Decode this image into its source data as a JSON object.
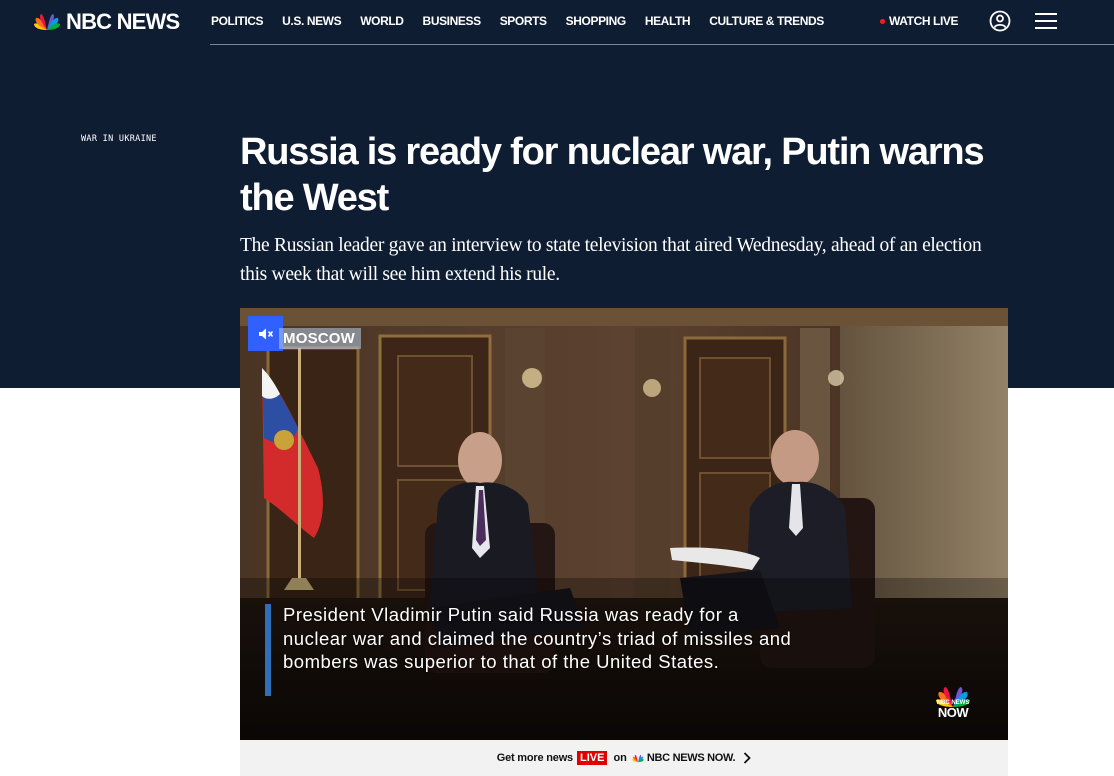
{
  "brand": {
    "logo_text": "NBC NEWS"
  },
  "nav": {
    "links": [
      "POLITICS",
      "U.S. NEWS",
      "WORLD",
      "BUSINESS",
      "SPORTS",
      "SHOPPING",
      "HEALTH",
      "CULTURE & TRENDS"
    ],
    "watch_live": "WATCH LIVE"
  },
  "article": {
    "eyebrow": "WAR IN UKRAINE",
    "headline": "Russia is ready for nuclear war, Putin warns the West",
    "dek": "The Russian leader gave an interview to state television that aired Wednesday, ahead of an election this week that will see him extend his rule."
  },
  "video": {
    "location": "MOSCOW",
    "caption": "President Vladimir Putin said Russia was ready for a nuclear war and claimed the country’s triad of missiles and bombers was superior to that of the United States.",
    "watermark_small": "NBC NEWS",
    "watermark_big": "NOW"
  },
  "promo": {
    "prefix": "Get more news",
    "live": "LIVE",
    "on": "on",
    "brand": "NBC NEWS NOW."
  },
  "colors": {
    "hero_bg": "#0f1d33",
    "mute_button": "#3061ff",
    "live_red": "#e00000"
  }
}
